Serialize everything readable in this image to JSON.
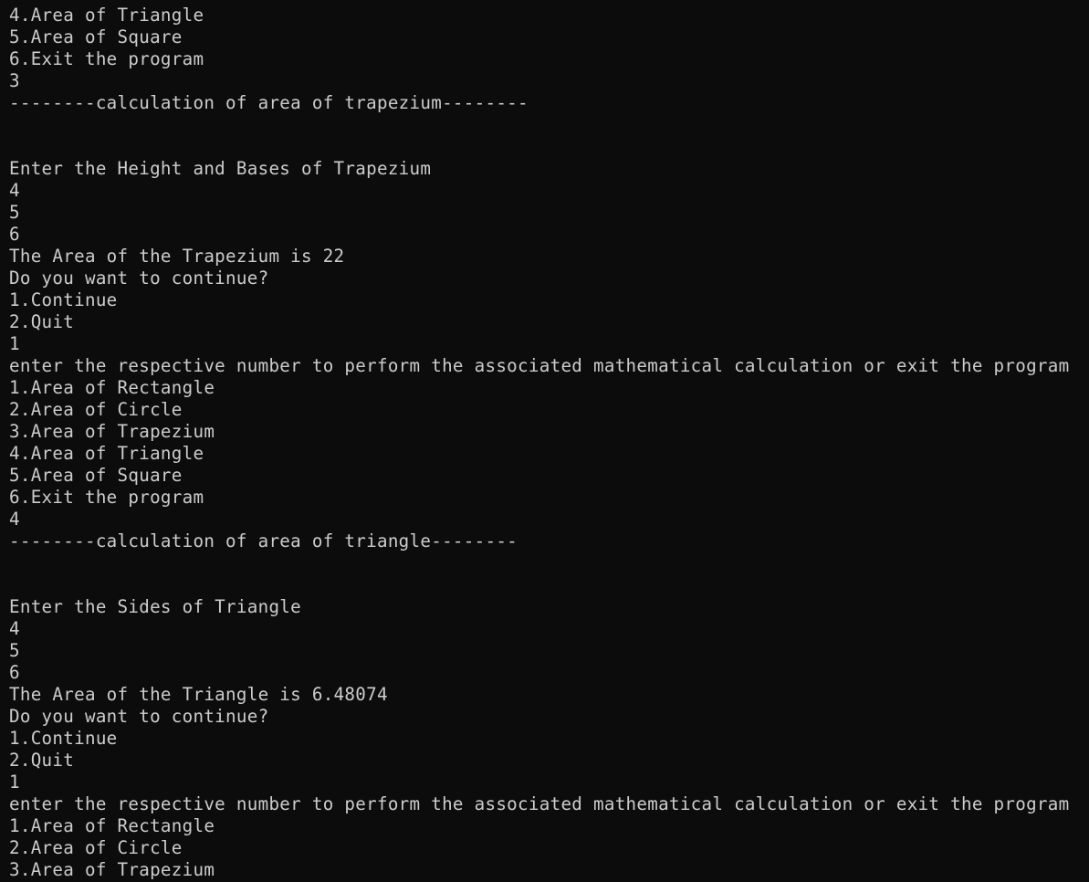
{
  "terminal": {
    "lines": [
      "4.Area of Triangle",
      "5.Area of Square",
      "6.Exit the program",
      "3",
      "--------calculation of area of trapezium--------",
      "",
      "",
      "Enter the Height and Bases of Trapezium",
      "4",
      "5",
      "6",
      "The Area of the Trapezium is 22",
      "Do you want to continue?",
      "1.Continue",
      "2.Quit",
      "1",
      "enter the respective number to perform the associated mathematical calculation or exit the program",
      "1.Area of Rectangle",
      "2.Area of Circle",
      "3.Area of Trapezium",
      "4.Area of Triangle",
      "5.Area of Square",
      "6.Exit the program",
      "4",
      "--------calculation of area of triangle--------",
      "",
      "",
      "Enter the Sides of Triangle",
      "4",
      "5",
      "6",
      "The Area of the Triangle is 6.48074",
      "Do you want to continue?",
      "1.Continue",
      "2.Quit",
      "1",
      "enter the respective number to perform the associated mathematical calculation or exit the program",
      "1.Area of Rectangle",
      "2.Area of Circle",
      "3.Area of Trapezium"
    ],
    "colors": {
      "background": "#0c0c0c",
      "foreground": "#cccccc"
    }
  }
}
